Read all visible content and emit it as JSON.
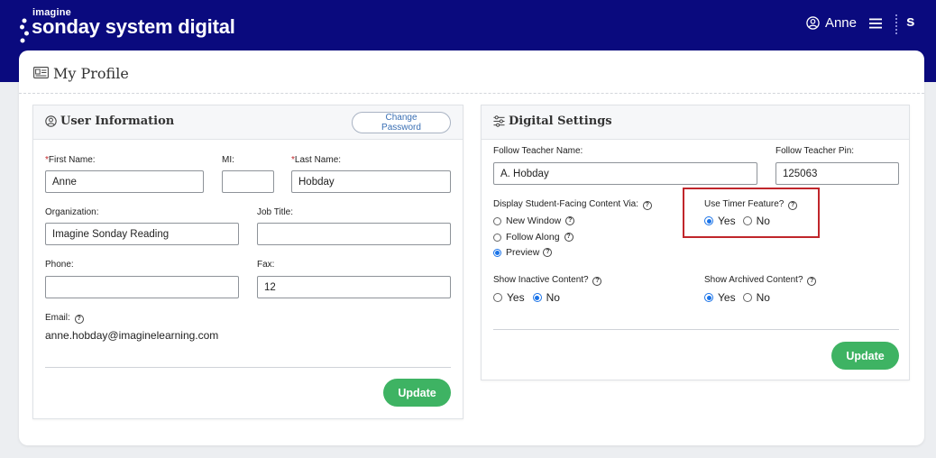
{
  "header": {
    "brand_small": "imagine",
    "brand_main": "sonday system digital",
    "user_name": "Anne",
    "s_logo": "s"
  },
  "page": {
    "title": "My Profile"
  },
  "user_info": {
    "title": "User Information",
    "change_password_label": "Change Password",
    "first_name_label": "First Name:",
    "first_name_value": "Anne",
    "mi_label": "MI:",
    "mi_value": "",
    "last_name_label": "Last Name:",
    "last_name_value": "Hobday",
    "required_mark": "*",
    "organization_label": "Organization:",
    "organization_value": "Imagine Sonday Reading",
    "job_title_label": "Job Title:",
    "job_title_value": "",
    "phone_label": "Phone:",
    "phone_value": "",
    "fax_label": "Fax:",
    "fax_value": "12",
    "email_label": "Email:",
    "email_value": "anne.hobday@imaginelearning.com",
    "update_label": "Update"
  },
  "digital_settings": {
    "title": "Digital Settings",
    "follow_teacher_name_label": "Follow Teacher Name:",
    "follow_teacher_name_value": "A. Hobday",
    "follow_teacher_pin_label": "Follow Teacher Pin:",
    "follow_teacher_pin_value": "125063",
    "display_via_label": "Display Student-Facing Content Via:",
    "display_via_options": [
      {
        "label": "New Window",
        "selected": false
      },
      {
        "label": "Follow Along",
        "selected": false
      },
      {
        "label": "Preview",
        "selected": true
      }
    ],
    "timer_label": "Use Timer Feature?",
    "timer_yes": "Yes",
    "timer_no": "No",
    "timer_value": "Yes",
    "inactive_label": "Show Inactive Content?",
    "inactive_yes": "Yes",
    "inactive_no": "No",
    "inactive_value": "No",
    "archived_label": "Show Archived Content?",
    "archived_yes": "Yes",
    "archived_no": "No",
    "archived_value": "Yes",
    "update_label": "Update"
  },
  "help_glyph": "?",
  "colors": {
    "header_bg": "#0a0a7e",
    "update_button": "#3eb363",
    "radio_selected": "#1a73e8",
    "highlight": "#c0262b",
    "required": "#c0262b"
  },
  "icons": [
    "user-circle-icon",
    "menu-icon",
    "id-card-icon",
    "sliders-icon",
    "help-icon"
  ]
}
